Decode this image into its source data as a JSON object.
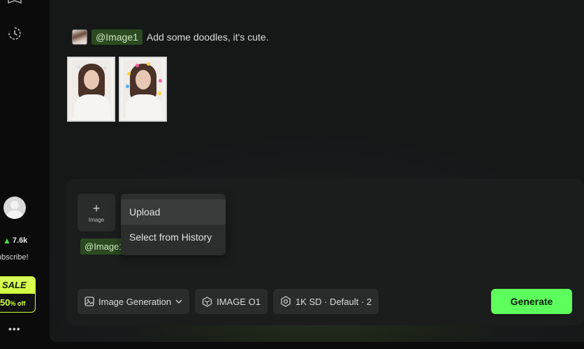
{
  "sidebar": {
    "credits": "7.6k",
    "subscribe_text": "ubscribe!",
    "sale": {
      "label": "SALE",
      "discount": "50",
      "discount_suffix": "% off"
    },
    "more": "•••"
  },
  "prompt": {
    "mention": "@Image1",
    "text": "Add some doodles, it's cute."
  },
  "composer": {
    "add_image_label": "Image",
    "mention": "@Image1",
    "upload_menu": [
      "Upload",
      "Select from History"
    ],
    "mode": "Image Generation",
    "model": "IMAGE O1",
    "settings": "1K SD · Default · 2",
    "generate_label": "Generate"
  },
  "colors": {
    "accent": "#5cff5c",
    "sale": "#d4ff3f",
    "tag_bg": "#2c4a21"
  }
}
